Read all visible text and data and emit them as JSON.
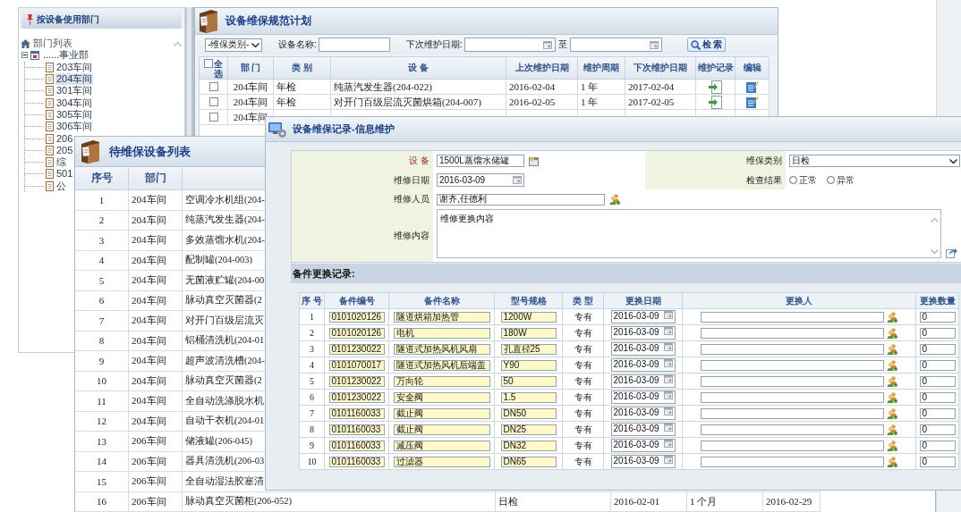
{
  "tree_panel": {
    "title": "按设备使用部门",
    "root": {
      "label": "部门列表",
      "children": [
        {
          "label": "......事业部",
          "expanded": true,
          "children": [
            {
              "label": "203车间",
              "selected": false
            },
            {
              "label": "204车间",
              "selected": true
            },
            {
              "label": "301车间",
              "selected": false
            },
            {
              "label": "304车间",
              "selected": false
            },
            {
              "label": "305车间",
              "selected": false
            },
            {
              "label": "306车间",
              "selected": false
            },
            {
              "label": "206",
              "selected": false
            },
            {
              "label": "205",
              "selected": false
            },
            {
              "label": "综",
              "selected": false
            },
            {
              "label": "501",
              "selected": false
            },
            {
              "label": "公",
              "selected": false
            }
          ]
        }
      ]
    }
  },
  "plan_window": {
    "title": "设备维保规范计划",
    "filters": {
      "category": "-维保类别-",
      "name_label": "设备名称:",
      "date_label": "下次维护日期:",
      "to_label": "至",
      "search_button": "检 索"
    },
    "table": {
      "select_all": {
        "label": "全选",
        "checked": false
      },
      "columns": [
        "部 门",
        "类 别",
        "设 备",
        "上次维护日期",
        "维护周期",
        "下次维护日期",
        "维护记录",
        "编辑"
      ],
      "rows": [
        {
          "checked": false,
          "cells": [
            "204车间",
            "年检",
            "纯蒸汽发生器(204-022)",
            "2016-02-04",
            "1 年",
            "2017-02-04"
          ],
          "actions": true
        },
        {
          "checked": false,
          "cells": [
            "204车间",
            "年检",
            "对开门百级层流灭菌烘箱(204-007)",
            "2016-02-05",
            "1 年",
            "2017-02-05"
          ],
          "actions": true
        },
        {
          "checked": false,
          "cells": [
            "204车间"
          ],
          "actions": false
        }
      ]
    }
  },
  "pending_window": {
    "title": "待维保设备列表",
    "columns": [
      "序号",
      "部门"
    ],
    "rows": [
      {
        "cells": [
          "1",
          "204车间",
          "空调冷水机组(204-"
        ]
      },
      {
        "cells": [
          "2",
          "204车间",
          "纯蒸汽发生器(204-"
        ]
      },
      {
        "cells": [
          "3",
          "204车间",
          "多效蒸馏水机(204-"
        ]
      },
      {
        "cells": [
          "4",
          "204车间",
          "配制罐(204-003)"
        ]
      },
      {
        "cells": [
          "5",
          "204车间",
          "无菌液贮罐(204-00"
        ]
      },
      {
        "cells": [
          "6",
          "204车间",
          "脉动真空灭菌器(2"
        ]
      },
      {
        "cells": [
          "7",
          "204车间",
          "对开门百级层流灭"
        ]
      },
      {
        "cells": [
          "8",
          "204车间",
          "铝桶清洗机(204-01"
        ]
      },
      {
        "cells": [
          "9",
          "204车间",
          "超声波清洗槽(204-"
        ]
      },
      {
        "cells": [
          "10",
          "204车间",
          "脉动真空灭菌器(2"
        ]
      },
      {
        "cells": [
          "11",
          "204车间",
          "全自动洗涤脱水机"
        ]
      },
      {
        "cells": [
          "12",
          "204车间",
          "自动干衣机(204-01"
        ]
      },
      {
        "cells": [
          "13",
          "206车间",
          "储液罐(206-045)"
        ]
      },
      {
        "cells": [
          "14",
          "206车间",
          "器具清洗机(206-03"
        ]
      },
      {
        "cells": [
          "15",
          "206车间",
          "全自动湿法胶塞清"
        ]
      },
      {
        "cells": [
          "16",
          "206车间",
          "脉动真空灭菌柜(206-052)",
          "日检",
          "2016-02-01",
          "1 个月",
          "2016-02-29"
        ]
      }
    ]
  },
  "dialog": {
    "title": "设备维保记录-信息维护",
    "form": {
      "left": [
        {
          "kind": "lookup",
          "label": "设 备",
          "value": "1500L蒸馏水储罐",
          "required": true
        },
        {
          "kind": "date",
          "label": "维修日期",
          "value": "2016-03-09",
          "required": false
        }
      ],
      "right": [
        {
          "kind": "select",
          "label": "维保类别",
          "value": "日检",
          "required": false
        },
        {
          "kind": "radio",
          "label": "检查结果",
          "required": false,
          "options": [
            {
              "label": "正常",
              "selected": false
            },
            {
              "label": "异常",
              "selected": false
            }
          ]
        }
      ],
      "wide": [
        {
          "kind": "people",
          "label": "维修人员",
          "value": "谢齐,任德利",
          "required": false
        },
        {
          "kind": "textarea",
          "label": "维修内容",
          "value": "维修更换内容",
          "required": false
        }
      ]
    },
    "parts": {
      "title": "备件更换记录:",
      "columns": [
        "序 号",
        "备件编号",
        "备件名称",
        "型号规格",
        "类 型",
        "更换日期",
        "更换人",
        "更换数量"
      ],
      "rows": [
        {
          "no": "1",
          "code": "0101020126",
          "name": "隧道烘箱加热管",
          "spec": "1200W",
          "type": "专有",
          "date": "2016-03-09",
          "qty": "0"
        },
        {
          "no": "2",
          "code": "0101020126",
          "name": "电机",
          "spec": "180W",
          "type": "专有",
          "date": "2016-03-09",
          "qty": "0"
        },
        {
          "no": "3",
          "code": "0101230022",
          "name": "隧道式加热风机风扇",
          "spec": "孔直径25",
          "type": "专有",
          "date": "2016-03-09",
          "qty": "0"
        },
        {
          "no": "4",
          "code": "0101070017",
          "name": "隧道式加热风机后端盖",
          "spec": "Y90",
          "type": "专有",
          "date": "2016-03-09",
          "qty": "0"
        },
        {
          "no": "5",
          "code": "0101230022",
          "name": "万向轮",
          "spec": "50",
          "type": "专有",
          "date": "2016-03-09",
          "qty": "0"
        },
        {
          "no": "6",
          "code": "0101230022",
          "name": "安全阀",
          "spec": "1.5",
          "type": "专有",
          "date": "2016-03-09",
          "qty": "0"
        },
        {
          "no": "7",
          "code": "0101160033",
          "name": "截止阀",
          "spec": "DN50",
          "type": "专有",
          "date": "2016-03-09",
          "qty": "0"
        },
        {
          "no": "8",
          "code": "0101160033",
          "name": "截止阀",
          "spec": "DN25",
          "type": "专有",
          "date": "2016-03-09",
          "qty": "0"
        },
        {
          "no": "9",
          "code": "0101160033",
          "name": "减压阀",
          "spec": "DN32",
          "type": "专有",
          "date": "2016-03-09",
          "qty": "0"
        },
        {
          "no": "10",
          "code": "0101160033",
          "name": "过滤器",
          "spec": "DN65",
          "type": "专有",
          "date": "2016-03-09",
          "qty": "0"
        }
      ]
    }
  }
}
